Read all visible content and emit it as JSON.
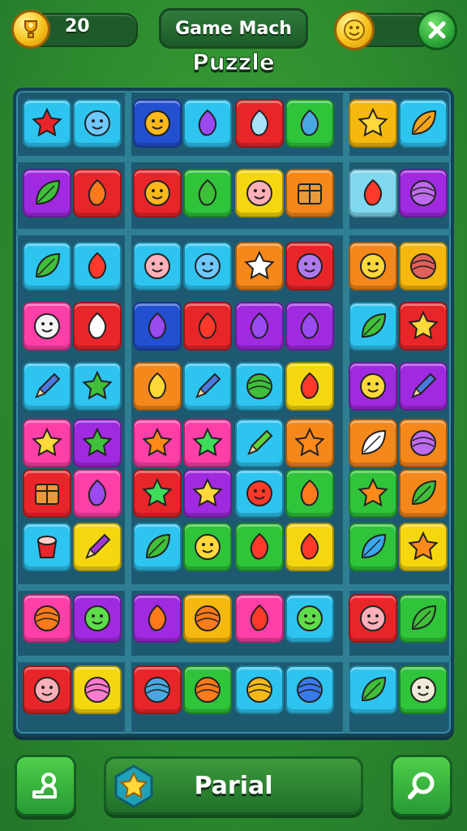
{
  "header": {
    "score": "20",
    "title": "Game Mach",
    "subtitle": "Puzzle"
  },
  "footer": {
    "status": "Parial"
  },
  "colors": {
    "background": "#2f8a2f",
    "board": "#1d5a72",
    "accent_green": "#2ea83a",
    "gold": "#f6c21a"
  },
  "board": {
    "rows": [
      [
        {
          "color": "#2ec4f0",
          "icon": "star-icon"
        },
        {
          "color": "#2ec4f0",
          "icon": "smiley-face-icon"
        },
        {
          "color": "#2250d0",
          "icon": "sun-face-icon"
        },
        {
          "color": "#2ec4f0",
          "icon": "purple-gem-icon"
        },
        {
          "color": "#e8262a",
          "icon": "water-drop-icon"
        },
        {
          "color": "#2fc43a",
          "icon": "potion-bottle-icon"
        },
        {
          "color": "#f5b80f",
          "icon": "gold-star-icon"
        },
        {
          "color": "#2ec4f0",
          "icon": "feather-icon"
        }
      ],
      [
        {
          "color": "#a02ae0",
          "icon": "green-leaf-icon"
        },
        {
          "color": "#e8262a",
          "icon": "orange-gem-icon"
        },
        {
          "color": "#e8262a",
          "icon": "sun-face-icon"
        },
        {
          "color": "#2fc43a",
          "icon": "green-blob-icon"
        },
        {
          "color": "#f5d70f",
          "icon": "pink-pig-icon"
        },
        {
          "color": "#f5881a",
          "icon": "crate-icon"
        },
        {
          "color": "#7fd8f0",
          "icon": "blue-blob-icon"
        },
        {
          "color": "#a02ae0",
          "icon": "purple-balloon-icon"
        }
      ],
      [
        {
          "color": "#2ec4f0",
          "icon": "leaf-icon"
        },
        {
          "color": "#2ec4f0",
          "icon": "tomato-icon"
        },
        {
          "color": "#2ec4f0",
          "icon": "pink-pig-icon"
        },
        {
          "color": "#2ec4f0",
          "icon": "smiley-face-icon"
        },
        {
          "color": "#f5881a",
          "icon": "white-star-icon"
        },
        {
          "color": "#e8262a",
          "icon": "purple-monster-icon"
        },
        {
          "color": "#f5881a",
          "icon": "yellow-face-icon"
        },
        {
          "color": "#f5b80f",
          "icon": "shell-icon"
        }
      ],
      [
        {
          "color": "#ff3fa8",
          "icon": "ghost-icon"
        },
        {
          "color": "#e8262a",
          "icon": "white-flame-icon"
        },
        {
          "color": "#2250d0",
          "icon": "purple-drop-icon"
        },
        {
          "color": "#e8262a",
          "icon": "red-apple-icon"
        },
        {
          "color": "#a02ae0",
          "icon": "purple-blob-icon"
        },
        {
          "color": "#a02ae0",
          "icon": "purple-shape-icon"
        },
        {
          "color": "#2ec4f0",
          "icon": "leaf-icon"
        },
        {
          "color": "#e8262a",
          "icon": "gold-star-icon"
        }
      ],
      [
        {
          "color": "#2ec4f0",
          "icon": "pencil-icon"
        },
        {
          "color": "#2ec4f0",
          "icon": "lightning-icon"
        },
        {
          "color": "#f5881a",
          "icon": "yellow-gem-icon"
        },
        {
          "color": "#2ec4f0",
          "icon": "pencil-icon"
        },
        {
          "color": "#2ec4f0",
          "icon": "ring-icon"
        },
        {
          "color": "#f5d70f",
          "icon": "red-flower-icon"
        },
        {
          "color": "#a02ae0",
          "icon": "cat-face-icon"
        },
        {
          "color": "#a02ae0",
          "icon": "pencil-icon"
        }
      ],
      [
        {
          "color": "#ff3fa8",
          "icon": "gold-star-icon"
        },
        {
          "color": "#a02ae0",
          "icon": "sparkle-icon"
        },
        {
          "color": "#ff3fa8",
          "icon": "burst-icon"
        },
        {
          "color": "#ff3fa8",
          "icon": "green-star-icon"
        },
        {
          "color": "#2ec4f0",
          "icon": "green-pencil-icon"
        },
        {
          "color": "#f5881a",
          "icon": "red-sun-icon"
        },
        {
          "color": "#f5881a",
          "icon": "white-leaf-icon"
        },
        {
          "color": "#f5881a",
          "icon": "purple-ball-icon"
        }
      ],
      [
        {
          "color": "#e8262a",
          "icon": "treasure-chest-icon"
        },
        {
          "color": "#ff3fa8",
          "icon": "purple-heart-icon"
        },
        {
          "color": "#e8262a",
          "icon": "green-star-icon"
        },
        {
          "color": "#a02ae0",
          "icon": "gold-star-icon"
        },
        {
          "color": "#2ec4f0",
          "icon": "red-face-icon"
        },
        {
          "color": "#2fc43a",
          "icon": "orange-gem-icon"
        },
        {
          "color": "#2fc43a",
          "icon": "orange-star-icon"
        },
        {
          "color": "#f5881a",
          "icon": "green-leaf-icon"
        }
      ],
      [
        {
          "color": "#2ec4f0",
          "icon": "cup-icon"
        },
        {
          "color": "#f5d70f",
          "icon": "magic-wand-icon"
        },
        {
          "color": "#2ec4f0",
          "icon": "green-leaf-icon"
        },
        {
          "color": "#2fc43a",
          "icon": "face-hat-icon"
        },
        {
          "color": "#2fc43a",
          "icon": "red-dragon-icon"
        },
        {
          "color": "#f5d70f",
          "icon": "red-bird-icon"
        },
        {
          "color": "#2fc43a",
          "icon": "blue-leaf-icon"
        },
        {
          "color": "#f5d70f",
          "icon": "orange-star-icon"
        }
      ],
      [
        {
          "color": "#ff3fa8",
          "icon": "melon-icon"
        },
        {
          "color": "#a02ae0",
          "icon": "green-face-icon"
        },
        {
          "color": "#a02ae0",
          "icon": "carrot-icon"
        },
        {
          "color": "#f5b80f",
          "icon": "orange-ball-icon"
        },
        {
          "color": "#ff3fa8",
          "icon": "chili-icon"
        },
        {
          "color": "#2ec4f0",
          "icon": "green-monster-icon"
        },
        {
          "color": "#e8262a",
          "icon": "pink-face-icon"
        },
        {
          "color": "#2fc43a",
          "icon": "fish-icon"
        }
      ],
      [
        {
          "color": "#e8262a",
          "icon": "pink-face-icon"
        },
        {
          "color": "#f5d70f",
          "icon": "pink-swirl-icon"
        },
        {
          "color": "#e8262a",
          "icon": "blue-orb-icon"
        },
        {
          "color": "#2fc43a",
          "icon": "orange-ball-icon"
        },
        {
          "color": "#2ec4f0",
          "icon": "swirl-candy-icon"
        },
        {
          "color": "#2ec4f0",
          "icon": "rainbow-icon"
        },
        {
          "color": "#2ec4f0",
          "icon": "green-leaf-icon"
        },
        {
          "color": "#2fc43a",
          "icon": "robot-icon"
        }
      ]
    ]
  }
}
